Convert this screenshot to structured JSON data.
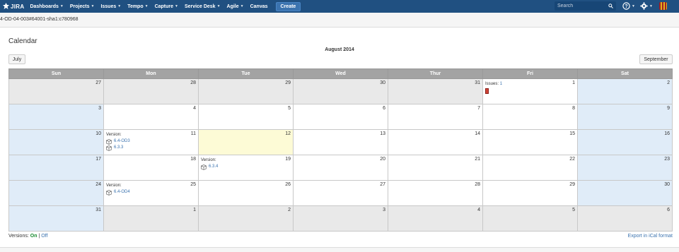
{
  "header": {
    "logo_text": "JIRA",
    "nav_items": [
      {
        "label": "Dashboards"
      },
      {
        "label": "Projects"
      },
      {
        "label": "Issues"
      },
      {
        "label": "Tempo"
      },
      {
        "label": "Capture"
      },
      {
        "label": "Service Desk"
      },
      {
        "label": "Agile"
      },
      {
        "label": "Canvas"
      }
    ],
    "create_label": "Create",
    "search_placeholder": "Search",
    "brand_color": "#205081"
  },
  "breadcrumb": "4-OD-04-003#64001-sha1:c780968",
  "calendar": {
    "title": "Calendar",
    "month": "August 2014",
    "prev_label": "July",
    "next_label": "September",
    "weekdays": [
      "Sun",
      "Mon",
      "Tue",
      "Wed",
      "Thur",
      "Fri",
      "Sat"
    ],
    "week1": {
      "d0": "27",
      "d1": "28",
      "d2": "29",
      "d3": "30",
      "d4": "31",
      "d5": "1",
      "d6": "2"
    },
    "week2": {
      "d0": "3",
      "d1": "4",
      "d2": "5",
      "d3": "6",
      "d4": "7",
      "d5": "8",
      "d6": "9"
    },
    "week3": {
      "d0": "10",
      "d1": "11",
      "d2": "12",
      "d3": "13",
      "d4": "14",
      "d5": "15",
      "d6": "16"
    },
    "week4": {
      "d0": "17",
      "d1": "18",
      "d2": "19",
      "d3": "20",
      "d4": "21",
      "d5": "22",
      "d6": "23"
    },
    "week5": {
      "d0": "24",
      "d1": "25",
      "d2": "26",
      "d3": "27",
      "d4": "28",
      "d5": "29",
      "d6": "30"
    },
    "week6": {
      "d0": "31",
      "d1": "1",
      "d2": "2",
      "d3": "3",
      "d4": "4",
      "d5": "5",
      "d6": "6"
    },
    "events": {
      "issues_label": "Issues:",
      "issues_count": "1",
      "version_label": "Version:",
      "aug11_versions": [
        "6.4-OD3",
        "6.3.3"
      ],
      "aug19_version": "6.3.4",
      "aug25_version": "6.4-OD4"
    }
  },
  "footer": {
    "versions_label": "Versions:",
    "on_label": "On",
    "separator": "|",
    "off_label": "Off",
    "export_label": "Export in iCal format"
  }
}
